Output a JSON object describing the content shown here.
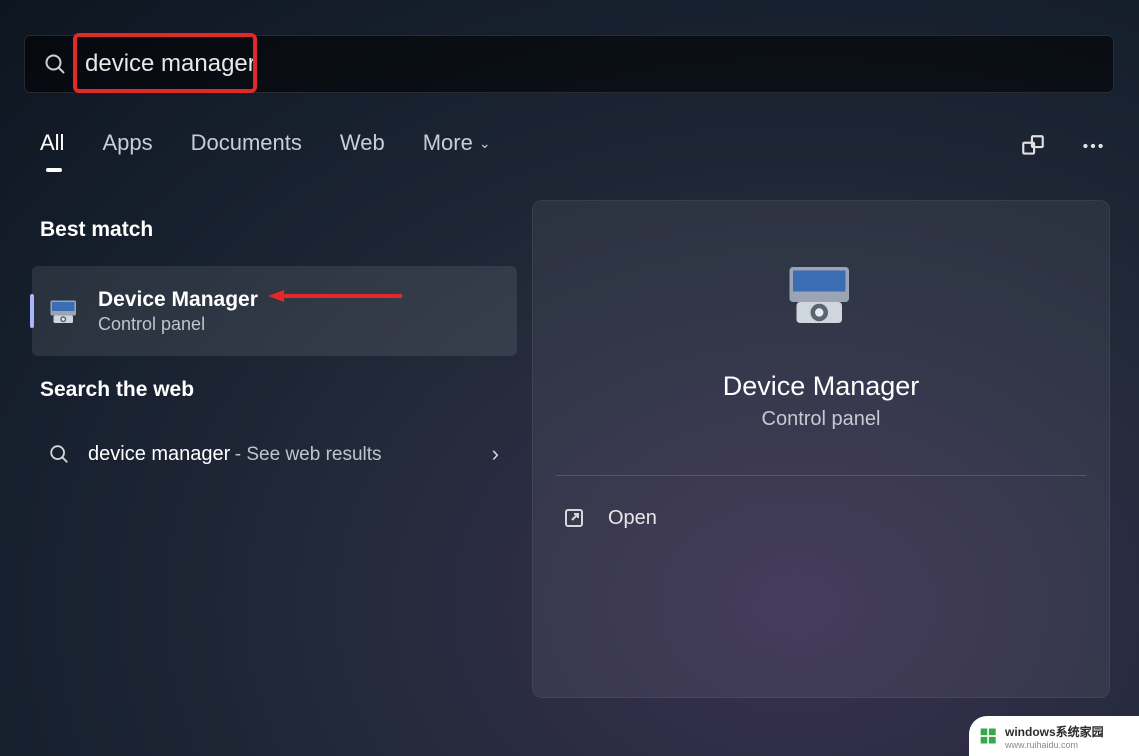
{
  "search": {
    "value": "device manager"
  },
  "tabs": {
    "items": [
      "All",
      "Apps",
      "Documents",
      "Web",
      "More"
    ],
    "active_index": 0
  },
  "sections": {
    "best_match_label": "Best match",
    "search_web_label": "Search the web"
  },
  "best_match": {
    "title": "Device Manager",
    "subtitle": "Control panel"
  },
  "web_result": {
    "query": "device manager",
    "hint": "- See web results"
  },
  "detail": {
    "title": "Device Manager",
    "subtitle": "Control panel",
    "actions": {
      "open": "Open"
    }
  },
  "watermark": {
    "brand": "windows",
    "tag": "系统家园",
    "url": "www.ruihaidu.com"
  },
  "annotations": {
    "search_highlight": true,
    "arrow_to_best_match": true
  }
}
